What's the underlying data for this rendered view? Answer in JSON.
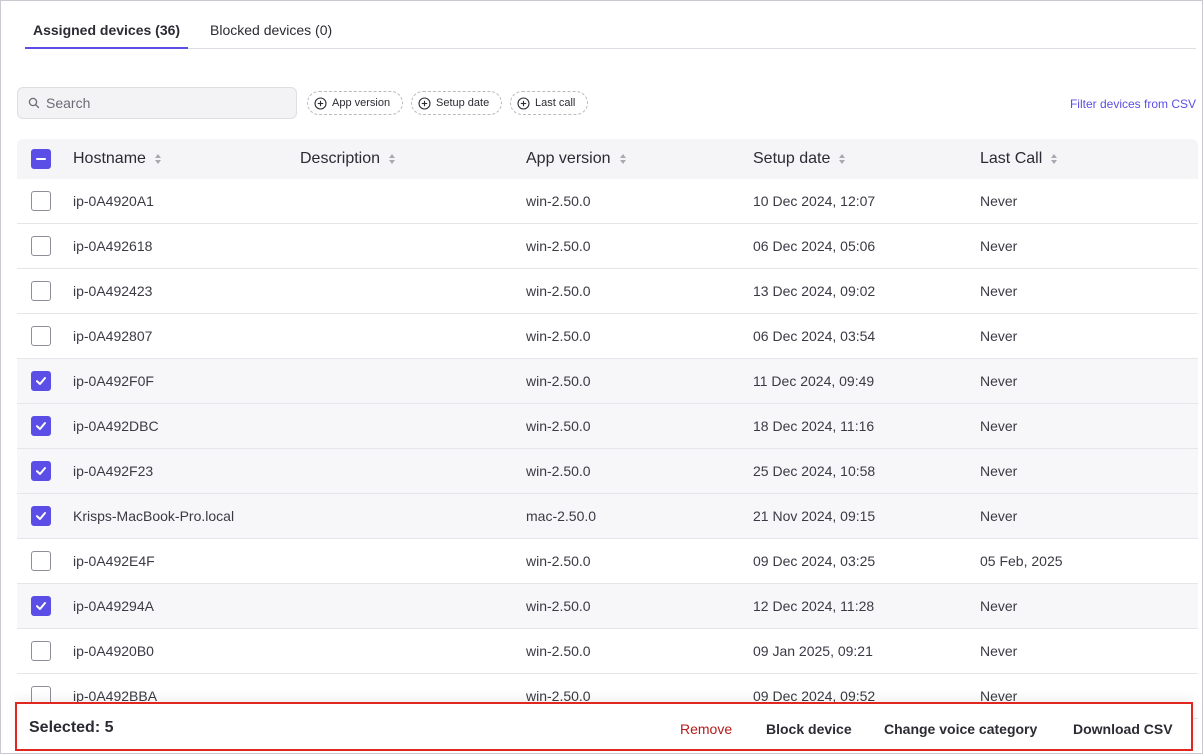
{
  "tabs": [
    {
      "label": "Assigned devices (36)",
      "active": true
    },
    {
      "label": "Blocked devices (0)",
      "active": false
    }
  ],
  "search": {
    "placeholder": "Search",
    "value": ""
  },
  "filter_chips": [
    "App version",
    "Setup date",
    "Last call"
  ],
  "filter_csv_link": "Filter devices from CSV",
  "table": {
    "columns": [
      "Hostname",
      "Description",
      "App version",
      "Setup date",
      "Last Call"
    ],
    "rows": [
      {
        "checked": false,
        "hostname": "ip-0A4920A1",
        "description": "",
        "app_version": "win-2.50.0",
        "setup_date": "10 Dec 2024, 12:07",
        "last_call": "Never"
      },
      {
        "checked": false,
        "hostname": "ip-0A492618",
        "description": "",
        "app_version": "win-2.50.0",
        "setup_date": "06 Dec 2024, 05:06",
        "last_call": "Never"
      },
      {
        "checked": false,
        "hostname": "ip-0A492423",
        "description": "",
        "app_version": "win-2.50.0",
        "setup_date": "13 Dec 2024, 09:02",
        "last_call": "Never"
      },
      {
        "checked": false,
        "hostname": "ip-0A492807",
        "description": "",
        "app_version": "win-2.50.0",
        "setup_date": "06 Dec 2024, 03:54",
        "last_call": "Never"
      },
      {
        "checked": true,
        "hostname": "ip-0A492F0F",
        "description": "",
        "app_version": "win-2.50.0",
        "setup_date": "11 Dec 2024, 09:49",
        "last_call": "Never"
      },
      {
        "checked": true,
        "hostname": "ip-0A492DBC",
        "description": "",
        "app_version": "win-2.50.0",
        "setup_date": "18 Dec 2024, 11:16",
        "last_call": "Never"
      },
      {
        "checked": true,
        "hostname": "ip-0A492F23",
        "description": "",
        "app_version": "win-2.50.0",
        "setup_date": "25 Dec 2024, 10:58",
        "last_call": "Never"
      },
      {
        "checked": true,
        "hostname": "Krisps-MacBook-Pro.local",
        "description": "",
        "app_version": "mac-2.50.0",
        "setup_date": "21 Nov 2024, 09:15",
        "last_call": "Never"
      },
      {
        "checked": false,
        "hostname": "ip-0A492E4F",
        "description": "",
        "app_version": "win-2.50.0",
        "setup_date": "09 Dec 2024, 03:25",
        "last_call": "05 Feb, 2025"
      },
      {
        "checked": true,
        "hostname": "ip-0A49294A",
        "description": "",
        "app_version": "win-2.50.0",
        "setup_date": "12 Dec 2024, 11:28",
        "last_call": "Never"
      },
      {
        "checked": false,
        "hostname": "ip-0A4920B0",
        "description": "",
        "app_version": "win-2.50.0",
        "setup_date": "09 Jan 2025, 09:21",
        "last_call": "Never"
      },
      {
        "checked": false,
        "hostname": "ip-0A492BBA",
        "description": "",
        "app_version": "win-2.50.0",
        "setup_date": "09 Dec 2024, 09:52",
        "last_call": "Never"
      }
    ]
  },
  "bottom_bar": {
    "selected_label": "Selected: 5",
    "actions": {
      "remove": "Remove",
      "block": "Block device",
      "voice": "Change voice category",
      "csv": "Download CSV"
    }
  },
  "colors": {
    "accent": "#5b4ee6",
    "danger": "#b31b1b",
    "highlight_border": "#e0261e"
  }
}
